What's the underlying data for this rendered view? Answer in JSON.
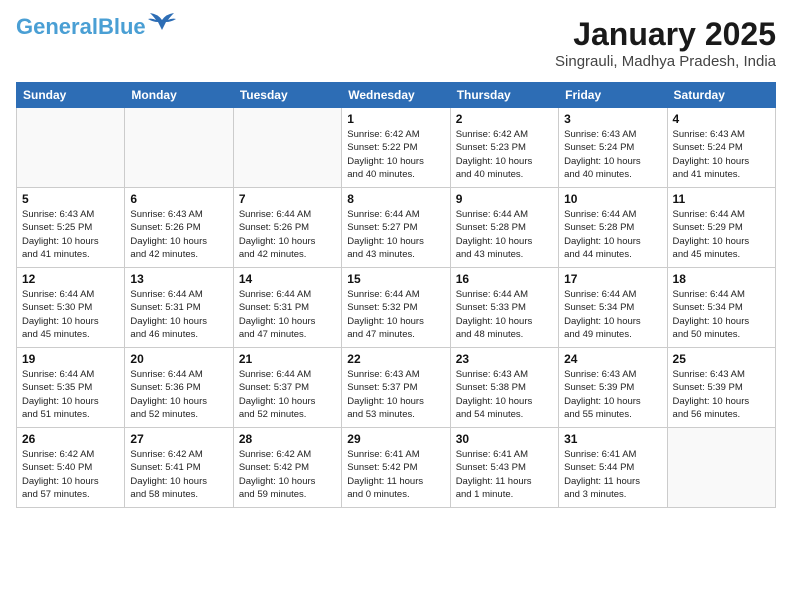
{
  "logo": {
    "general": "General",
    "blue": "Blue"
  },
  "header": {
    "month": "January 2025",
    "location": "Singrauli, Madhya Pradesh, India"
  },
  "weekdays": [
    "Sunday",
    "Monday",
    "Tuesday",
    "Wednesday",
    "Thursday",
    "Friday",
    "Saturday"
  ],
  "weeks": [
    [
      {
        "day": "",
        "info": ""
      },
      {
        "day": "",
        "info": ""
      },
      {
        "day": "",
        "info": ""
      },
      {
        "day": "1",
        "info": "Sunrise: 6:42 AM\nSunset: 5:22 PM\nDaylight: 10 hours\nand 40 minutes."
      },
      {
        "day": "2",
        "info": "Sunrise: 6:42 AM\nSunset: 5:23 PM\nDaylight: 10 hours\nand 40 minutes."
      },
      {
        "day": "3",
        "info": "Sunrise: 6:43 AM\nSunset: 5:24 PM\nDaylight: 10 hours\nand 40 minutes."
      },
      {
        "day": "4",
        "info": "Sunrise: 6:43 AM\nSunset: 5:24 PM\nDaylight: 10 hours\nand 41 minutes."
      }
    ],
    [
      {
        "day": "5",
        "info": "Sunrise: 6:43 AM\nSunset: 5:25 PM\nDaylight: 10 hours\nand 41 minutes."
      },
      {
        "day": "6",
        "info": "Sunrise: 6:43 AM\nSunset: 5:26 PM\nDaylight: 10 hours\nand 42 minutes."
      },
      {
        "day": "7",
        "info": "Sunrise: 6:44 AM\nSunset: 5:26 PM\nDaylight: 10 hours\nand 42 minutes."
      },
      {
        "day": "8",
        "info": "Sunrise: 6:44 AM\nSunset: 5:27 PM\nDaylight: 10 hours\nand 43 minutes."
      },
      {
        "day": "9",
        "info": "Sunrise: 6:44 AM\nSunset: 5:28 PM\nDaylight: 10 hours\nand 43 minutes."
      },
      {
        "day": "10",
        "info": "Sunrise: 6:44 AM\nSunset: 5:28 PM\nDaylight: 10 hours\nand 44 minutes."
      },
      {
        "day": "11",
        "info": "Sunrise: 6:44 AM\nSunset: 5:29 PM\nDaylight: 10 hours\nand 45 minutes."
      }
    ],
    [
      {
        "day": "12",
        "info": "Sunrise: 6:44 AM\nSunset: 5:30 PM\nDaylight: 10 hours\nand 45 minutes."
      },
      {
        "day": "13",
        "info": "Sunrise: 6:44 AM\nSunset: 5:31 PM\nDaylight: 10 hours\nand 46 minutes."
      },
      {
        "day": "14",
        "info": "Sunrise: 6:44 AM\nSunset: 5:31 PM\nDaylight: 10 hours\nand 47 minutes."
      },
      {
        "day": "15",
        "info": "Sunrise: 6:44 AM\nSunset: 5:32 PM\nDaylight: 10 hours\nand 47 minutes."
      },
      {
        "day": "16",
        "info": "Sunrise: 6:44 AM\nSunset: 5:33 PM\nDaylight: 10 hours\nand 48 minutes."
      },
      {
        "day": "17",
        "info": "Sunrise: 6:44 AM\nSunset: 5:34 PM\nDaylight: 10 hours\nand 49 minutes."
      },
      {
        "day": "18",
        "info": "Sunrise: 6:44 AM\nSunset: 5:34 PM\nDaylight: 10 hours\nand 50 minutes."
      }
    ],
    [
      {
        "day": "19",
        "info": "Sunrise: 6:44 AM\nSunset: 5:35 PM\nDaylight: 10 hours\nand 51 minutes."
      },
      {
        "day": "20",
        "info": "Sunrise: 6:44 AM\nSunset: 5:36 PM\nDaylight: 10 hours\nand 52 minutes."
      },
      {
        "day": "21",
        "info": "Sunrise: 6:44 AM\nSunset: 5:37 PM\nDaylight: 10 hours\nand 52 minutes."
      },
      {
        "day": "22",
        "info": "Sunrise: 6:43 AM\nSunset: 5:37 PM\nDaylight: 10 hours\nand 53 minutes."
      },
      {
        "day": "23",
        "info": "Sunrise: 6:43 AM\nSunset: 5:38 PM\nDaylight: 10 hours\nand 54 minutes."
      },
      {
        "day": "24",
        "info": "Sunrise: 6:43 AM\nSunset: 5:39 PM\nDaylight: 10 hours\nand 55 minutes."
      },
      {
        "day": "25",
        "info": "Sunrise: 6:43 AM\nSunset: 5:39 PM\nDaylight: 10 hours\nand 56 minutes."
      }
    ],
    [
      {
        "day": "26",
        "info": "Sunrise: 6:42 AM\nSunset: 5:40 PM\nDaylight: 10 hours\nand 57 minutes."
      },
      {
        "day": "27",
        "info": "Sunrise: 6:42 AM\nSunset: 5:41 PM\nDaylight: 10 hours\nand 58 minutes."
      },
      {
        "day": "28",
        "info": "Sunrise: 6:42 AM\nSunset: 5:42 PM\nDaylight: 10 hours\nand 59 minutes."
      },
      {
        "day": "29",
        "info": "Sunrise: 6:41 AM\nSunset: 5:42 PM\nDaylight: 11 hours\nand 0 minutes."
      },
      {
        "day": "30",
        "info": "Sunrise: 6:41 AM\nSunset: 5:43 PM\nDaylight: 11 hours\nand 1 minute."
      },
      {
        "day": "31",
        "info": "Sunrise: 6:41 AM\nSunset: 5:44 PM\nDaylight: 11 hours\nand 3 minutes."
      },
      {
        "day": "",
        "info": ""
      }
    ]
  ]
}
